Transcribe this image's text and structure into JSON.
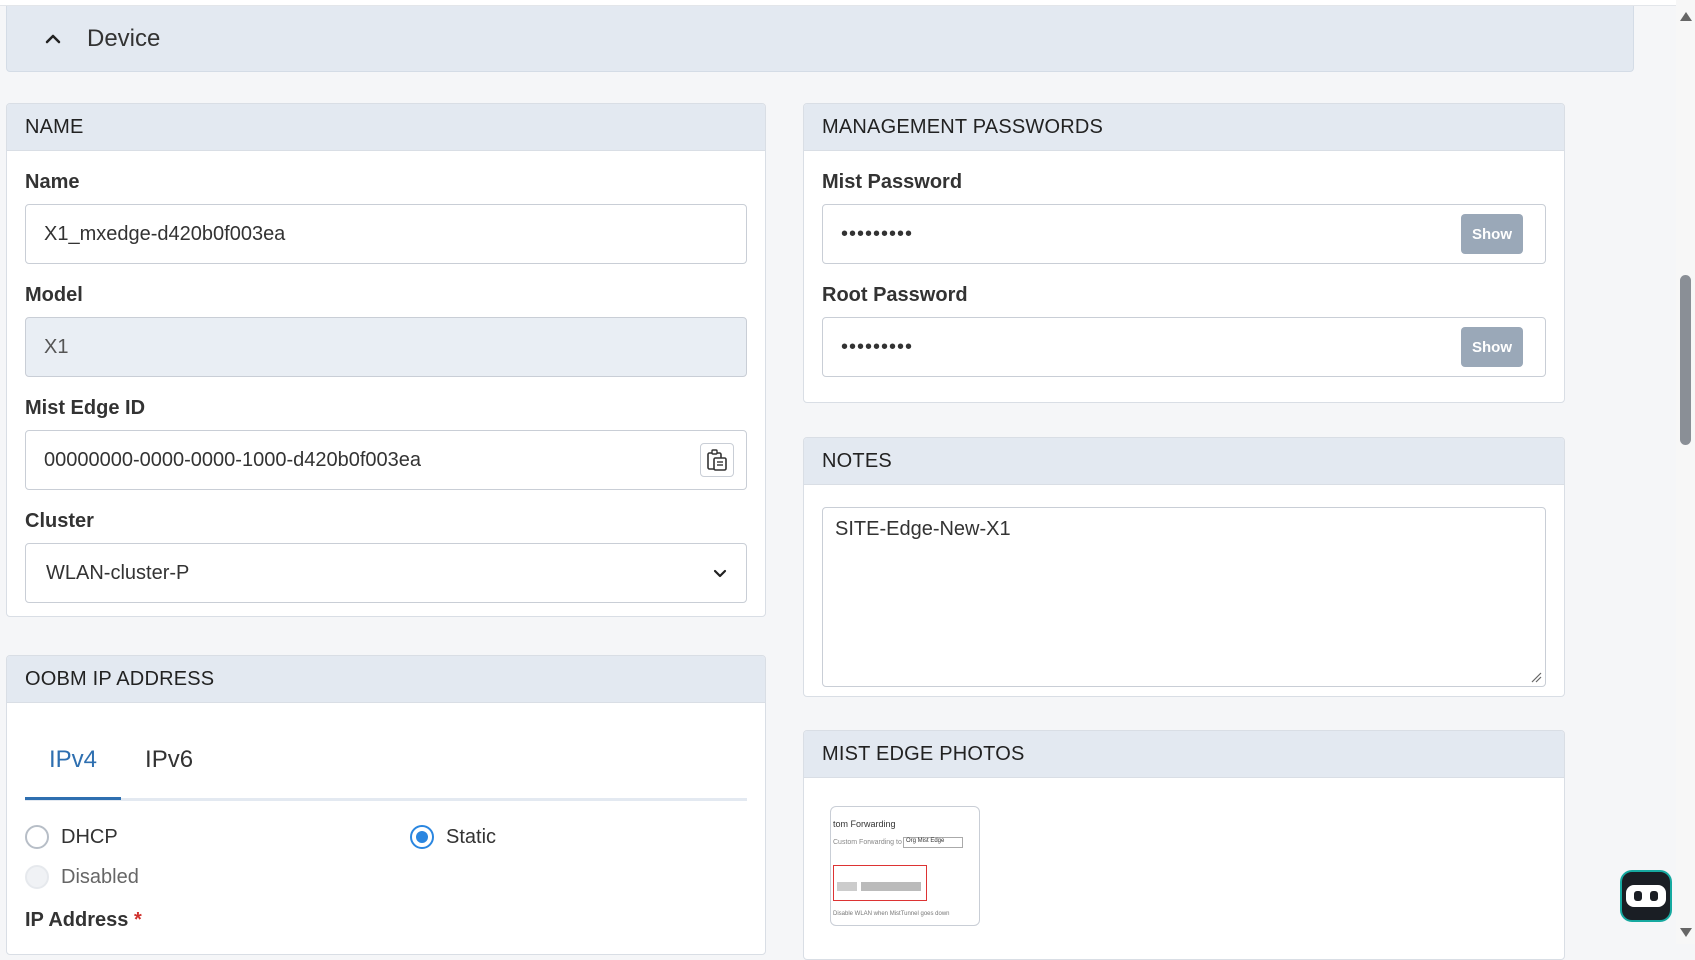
{
  "section": {
    "title": "Device"
  },
  "name_card": {
    "header": "NAME",
    "name_label": "Name",
    "name_value": "X1_mxedge-d420b0f003ea",
    "model_label": "Model",
    "model_value": "X1",
    "edge_id_label": "Mist Edge ID",
    "edge_id_value": "00000000-0000-0000-1000-d420b0f003ea",
    "cluster_label": "Cluster",
    "cluster_value": "WLAN-cluster-P"
  },
  "oobm_card": {
    "header": "OOBM IP ADDRESS",
    "tabs": [
      "IPv4",
      "IPv6"
    ],
    "active_tab": "IPv4",
    "radio_dhcp": "DHCP",
    "radio_static": "Static",
    "radio_disabled": "Disabled",
    "selected": "Static",
    "ip_label": "IP Address",
    "required_mark": "*"
  },
  "passwords_card": {
    "header": "MANAGEMENT PASSWORDS",
    "mist_label": "Mist Password",
    "mist_value": "•••••••••",
    "root_label": "Root Password",
    "root_value": "•••••••••",
    "show_label": "Show"
  },
  "notes_card": {
    "header": "NOTES",
    "value": "SITE-Edge-New-X1"
  },
  "photos_card": {
    "header": "MIST EDGE PHOTOS",
    "thumb_title": "tom Forwarding",
    "thumb_line": "Custom Forwarding to",
    "thumb_select": "Org Mist Edge",
    "thumb_bottom": "Disable WLAN when MistTunnel goes down"
  },
  "colors": {
    "accent": "#2e6fb0",
    "radio": "#2a86e0",
    "header_bg": "#e3e9f1"
  },
  "icons": [
    "chevron-up-icon",
    "copy-icon",
    "chevron-down-icon",
    "chatbot-icon"
  ]
}
